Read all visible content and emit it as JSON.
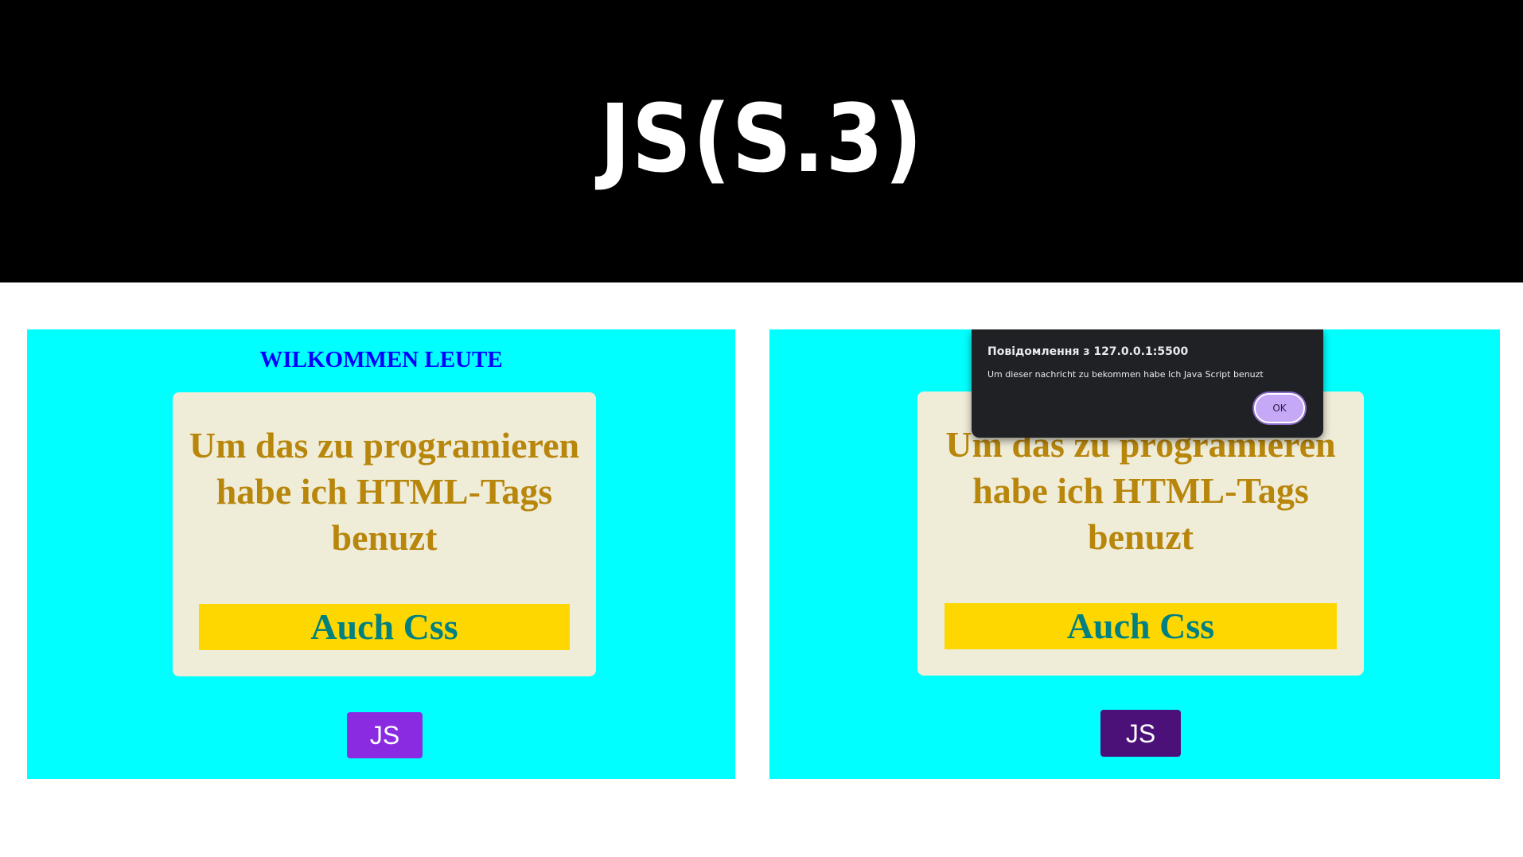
{
  "header": {
    "title": "JS(S.3)"
  },
  "left_panel": {
    "welcome": "WILKOMMEN LEUTE",
    "card_text": "Um das zu programieren habe ich HTML-Tags benuzt",
    "css_label": "Auch Css",
    "js_button": "JS"
  },
  "right_panel": {
    "card_text": "Um das zu programieren habe ich HTML-Tags benuzt",
    "css_label": "Auch Css",
    "js_button": "JS",
    "dialog": {
      "title": "Повідомлення з 127.0.0.1:5500",
      "message": "Um dieser nachricht zu bekommen habe Ich Java Script benuzt",
      "ok_label": "OK"
    }
  },
  "colors": {
    "header_bg": "#000000",
    "panel_bg": "#00ffff",
    "welcome_text": "#0000ff",
    "card_bg": "#efecd8",
    "card_text": "#b8860b",
    "css_bar_bg": "#ffd700",
    "css_bar_text": "#008080",
    "js_button_left": "#8a2be2",
    "js_button_right": "#4b1178",
    "dialog_bg": "#202124",
    "dialog_ok_bg": "#c6a9f6"
  }
}
